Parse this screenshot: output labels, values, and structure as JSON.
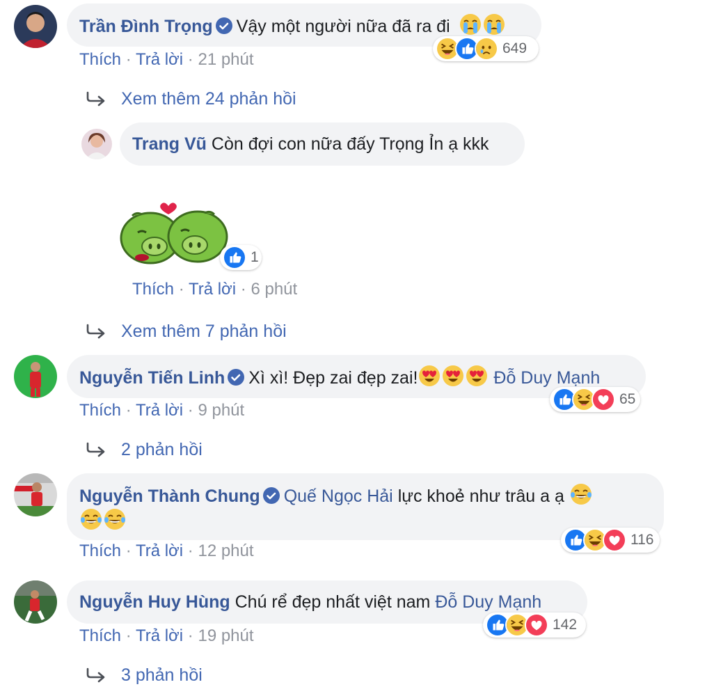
{
  "comments": [
    {
      "name": "Trần Đình Trọng",
      "text": "Vậy một người nữa đã ra đi",
      "reactions_count": "649",
      "actions": {
        "like": "Thích",
        "reply": "Trả lời",
        "time": "21 phút"
      },
      "view_more": "Xem thêm 24 phản hồi"
    },
    {
      "name": "Trang Vũ",
      "text": "Còn đợi con nữa đấy Trọng Ỉn ạ kkk",
      "sticker_reactions_count": "1",
      "actions": {
        "like": "Thích",
        "reply": "Trả lời",
        "time": "6 phút"
      },
      "view_more": "Xem thêm 7 phản hồi"
    },
    {
      "name": "Nguyễn Tiến Linh",
      "text": "Xì xì! Đẹp zai đẹp zai!",
      "tag": "Đỗ Duy Mạnh",
      "reactions_count": "65",
      "actions": {
        "like": "Thích",
        "reply": "Trả lời",
        "time": "9 phút"
      },
      "view_more": "2 phản hồi"
    },
    {
      "name": "Nguyễn Thành Chung",
      "tag": "Quế Ngọc Hải",
      "text": "lực khoẻ như trâu a ạ",
      "reactions_count": "116",
      "actions": {
        "like": "Thích",
        "reply": "Trả lời",
        "time": "12 phút"
      }
    },
    {
      "name": "Nguyễn Huy Hùng",
      "text": "Chú rể đẹp nhất việt nam",
      "tag": "Đỗ Duy Mạnh",
      "reactions_count": "142",
      "actions": {
        "like": "Thích",
        "reply": "Trả lời",
        "time": "19 phút"
      },
      "view_more": "3 phản hồi"
    }
  ],
  "separator": "·",
  "colors": {
    "link": "#385898",
    "action": "#4267b2",
    "meta": "#90949c",
    "bubble": "#f2f3f5"
  }
}
